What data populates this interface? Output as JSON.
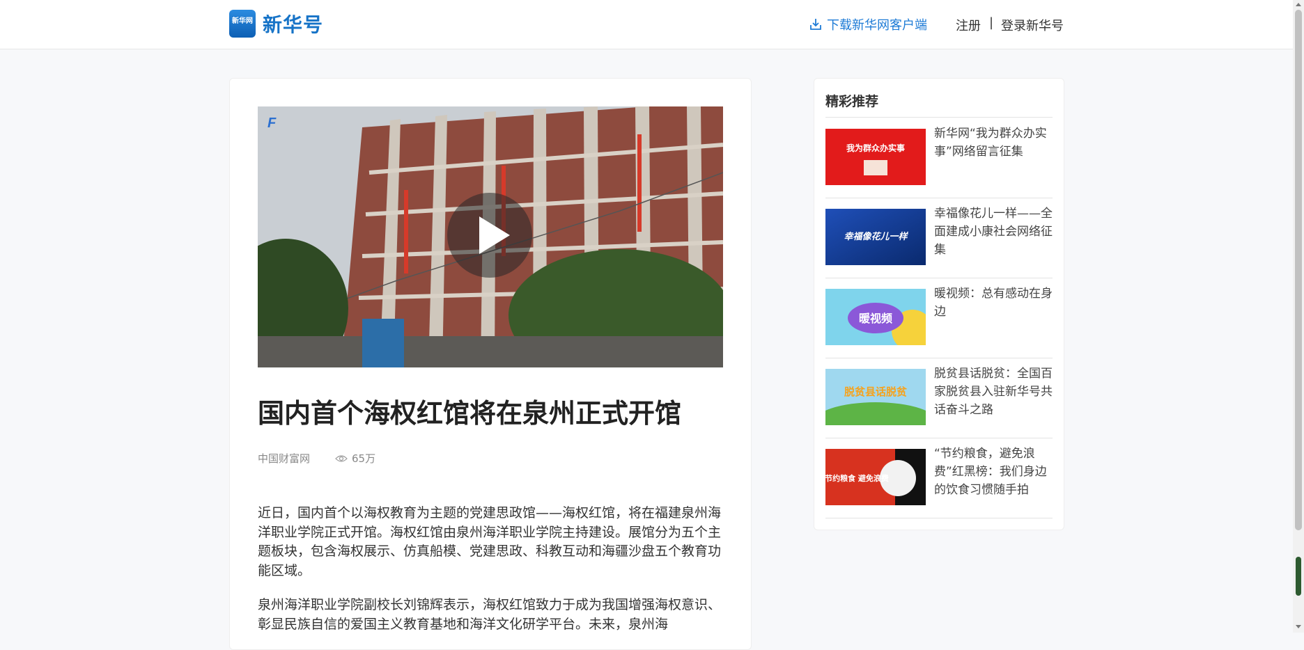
{
  "header": {
    "logo_badge": "新华网",
    "logo_text": "新华号",
    "download_label": "下载新华网客户端",
    "register_label": "注册",
    "separator": "|",
    "login_label": "登录新华号"
  },
  "article": {
    "title": "国内首个海权红馆将在泉州正式开馆",
    "source": "中国财富网",
    "views": "65万",
    "paragraphs": [
      "近日，国内首个以海权教育为主题的党建思政馆——海权红馆，将在福建泉州海洋职业学院正式开馆。海权红馆由泉州海洋职业学院主持建设。展馆分为五个主题板块，包含海权展示、仿真船模、党建思政、科教互动和海疆沙盘五个教育功能区域。",
      "泉州海洋职业学院副校长刘锦辉表示，海权红馆致力于成为我国增强海权意识、彰显民族自信的爱国主义教育基地和海洋文化研学平台。未来，泉州海"
    ]
  },
  "sidebar": {
    "title": "精彩推荐",
    "items": [
      {
        "label": "新华网“我为群众办实事”网络留言征集",
        "thumb_text": "我为群众办实事"
      },
      {
        "label": "幸福像花儿一样——全面建成小康社会网络征集",
        "thumb_text": "幸福像花儿一样"
      },
      {
        "label": "暖视频：总有感动在身边",
        "thumb_text": "暖视频"
      },
      {
        "label": "脱贫县话脱贫：全国百家脱贫县入驻新华号共话奋斗之路",
        "thumb_text": "脱贫县话脱贫"
      },
      {
        "label": "“节约粮食，避免浪费”红黑榜：我们身边的饮食习惯随手拍",
        "thumb_text": "节约粮食 避免浪费"
      }
    ]
  },
  "colors": {
    "accent": "#1e7bd6",
    "page_bg": "#f7f8fa"
  }
}
